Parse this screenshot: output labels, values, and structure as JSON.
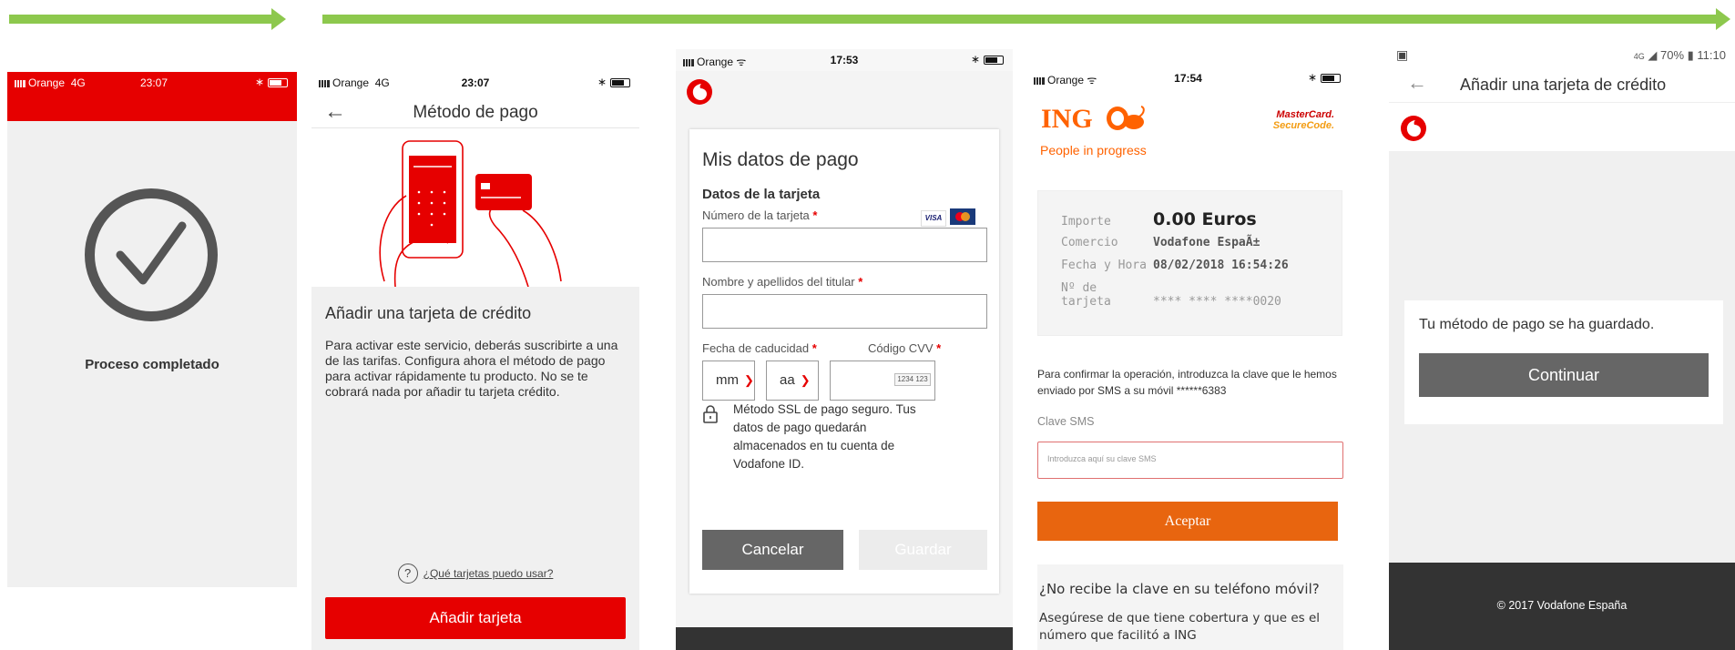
{
  "colors": {
    "arrow": "#8dc84d",
    "vodafone_red": "#e60000",
    "ing_orange": "#ff6200",
    "accept_orange": "#e8650f",
    "dark_grey": "#666666"
  },
  "screen1": {
    "status": {
      "carrier": "Orange",
      "network": "4G",
      "time": "23:07"
    },
    "icon": "check-circle-icon",
    "message": "Proceso completado"
  },
  "screen2": {
    "status": {
      "carrier": "Orange",
      "network": "4G",
      "time": "23:07"
    },
    "back_icon": "arrow-left-icon",
    "title": "Método de pago",
    "illustration": "phone-and-card-illustration",
    "heading": "Añadir una tarjeta de crédito",
    "body": "Para activar este servicio, deberás suscribirte a una de las tarifas. Configura ahora el método de pago para activar rápidamente tu producto. No se te cobrará nada por añadir tu tarjeta crédito.",
    "help_icon": "question-circle-icon",
    "help_link": "¿Qué tarjetas puedo usar?",
    "button": "Añadir tarjeta"
  },
  "screen3": {
    "status": {
      "carrier": "Orange",
      "time": "17:53"
    },
    "logo": "vodafone-logo-icon",
    "title": "Mis datos de pago",
    "subtitle": "Datos de la tarjeta",
    "card_number_label": "Número de la tarjeta",
    "holder_label": "Nombre y apellidos del titular",
    "expiry_label": "Fecha de caducidad",
    "cvv_label": "Código CVV",
    "required_mark": "*",
    "month_value": "mm",
    "year_value": "aa",
    "cvv_hint": "1234 123",
    "card_brands": [
      "VISA",
      "MasterCard"
    ],
    "lock_icon": "lock-icon",
    "ssl_text": "Método SSL de pago seguro. Tus datos de pago quedarán almacenados en tu cuenta de Vodafone ID.",
    "cancel_button": "Cancelar",
    "save_button": "Guardar"
  },
  "screen4": {
    "status": {
      "carrier": "Orange",
      "time": "17:54"
    },
    "bank_name": "ING",
    "bank_tagline": "People in progress",
    "securecode_line1": "MasterCard.",
    "securecode_line2": "SecureCode.",
    "rows": [
      {
        "key": "Importe",
        "value": "0.00 Euros"
      },
      {
        "key": "Comercio",
        "value": "Vodafone EspaÃ±"
      },
      {
        "key": "Fecha y Hora",
        "value": "08/02/2018  16:54:26"
      },
      {
        "key": "Nº de tarjeta",
        "value": "**** **** ****0020"
      }
    ],
    "message": "Para confirmar la operación, introduzca la clave que le hemos enviado por SMS a su móvil ******6383",
    "sms_label": "Clave SMS",
    "sms_placeholder": "Introduzca aquí su clave SMS",
    "accept_button": "Aceptar",
    "faq_question": "¿No recibe la clave en su teléfono móvil?",
    "faq_answer": "Asegúrese de que tiene cobertura y que es el número que facilitó a ING"
  },
  "screen5": {
    "status": {
      "network": "4G",
      "battery": "70%",
      "time": "11:10"
    },
    "back_icon": "arrow-left-icon",
    "title": "Añadir una tarjeta de crédito",
    "logo": "vodafone-logo-icon",
    "message": "Tu método de pago se ha guardado.",
    "button": "Continuar",
    "footer": "© 2017 Vodafone España"
  }
}
